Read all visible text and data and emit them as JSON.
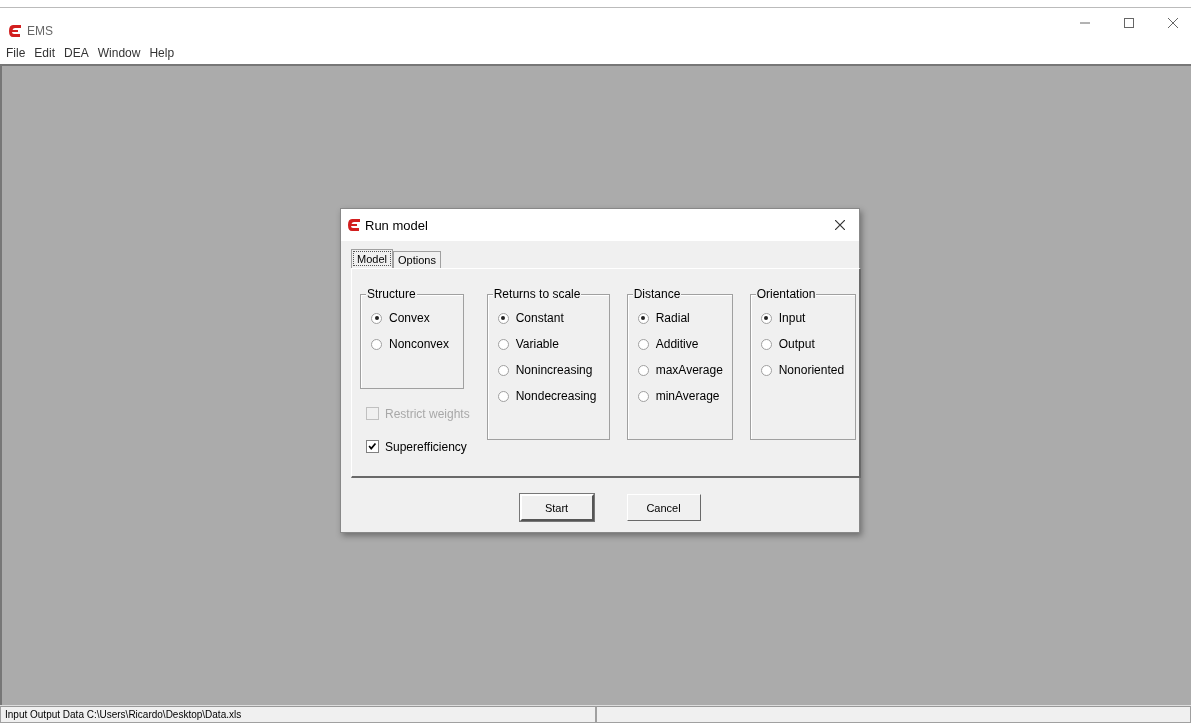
{
  "window": {
    "title": "EMS"
  },
  "menu": [
    "File",
    "Edit",
    "DEA",
    "Window",
    "Help"
  ],
  "dialog": {
    "title": "Run model",
    "tabs": [
      {
        "label": "Model",
        "selected": true
      },
      {
        "label": "Options",
        "selected": false
      }
    ],
    "groups": [
      {
        "title": "Structure",
        "options": [
          {
            "label": "Convex",
            "selected": true
          },
          {
            "label": "Nonconvex",
            "selected": false
          }
        ]
      },
      {
        "title": "Returns to scale",
        "options": [
          {
            "label": "Constant",
            "selected": true
          },
          {
            "label": "Variable",
            "selected": false
          },
          {
            "label": "Nonincreasing",
            "selected": false
          },
          {
            "label": "Nondecreasing",
            "selected": false
          }
        ]
      },
      {
        "title": "Distance",
        "options": [
          {
            "label": "Radial",
            "selected": true
          },
          {
            "label": "Additive",
            "selected": false
          },
          {
            "label": "maxAverage",
            "selected": false
          },
          {
            "label": "minAverage",
            "selected": false
          }
        ]
      },
      {
        "title": "Orientation",
        "options": [
          {
            "label": "Input",
            "selected": true
          },
          {
            "label": "Output",
            "selected": false
          },
          {
            "label": "Nonoriented",
            "selected": false
          }
        ]
      }
    ],
    "checkboxes": [
      {
        "label": "Restrict weights",
        "checked": false,
        "disabled": true
      },
      {
        "label": "Superefficiency",
        "checked": true,
        "disabled": false
      }
    ],
    "buttons": [
      {
        "label": "Start",
        "default": true
      },
      {
        "label": "Cancel",
        "default": false
      }
    ]
  },
  "status_bar": [
    "Input Output Data C:\\Users\\Ricardo\\Desktop\\Data.xls"
  ]
}
